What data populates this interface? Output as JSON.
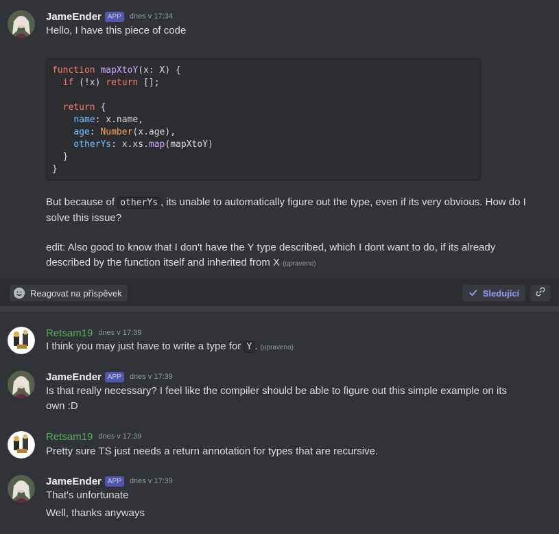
{
  "posts": {
    "first": {
      "author": "JameEnder",
      "badge": "APP",
      "time": "dnes v 17:34",
      "line1": "Hello, I have this piece of code",
      "code_lines": [
        "function mapXtoY(x: X) {",
        "  if (!x) return [];",
        "",
        "  return {",
        "    name: x.name,",
        "    age: Number(x.age),",
        "    otherYs: x.xs.map(mapXtoY)",
        "  }",
        "}"
      ],
      "para1_a": "But because of ",
      "para1_code": "otherYs",
      "para1_b": ", its unable to automatically figure out the type, even if its very obvious. How do I solve this issue?",
      "para2": "edit: Also good to know that I don't have the Y type described, which I dont want to do, if its already described by the function itself and inherited from X",
      "edited": "(upraveno)"
    }
  },
  "thread_bar": {
    "react_label": "Reagovat na příspěvek",
    "follow_label": "Sledující"
  },
  "replies": [
    {
      "author": "Retsam19",
      "time": "dnes v 17:39",
      "text_a": "I think you may just have to write a type for ",
      "code": "Y",
      "text_b": ".",
      "edited": "(upraveno)"
    },
    {
      "author": "JameEnder",
      "badge": "APP",
      "time": "dnes v 17:39",
      "text": "Is that really necessary? I feel like the compiler should be able to figure out this simple example on its own :D"
    },
    {
      "author": "Retsam19",
      "time": "dnes v 17:39",
      "text": "Pretty sure TS just needs a return annotation for types that are recursive."
    },
    {
      "author": "JameEnder",
      "badge": "APP",
      "time": "dnes v 17:39",
      "text": "That's unfortunate",
      "text2": "Well, thanks anyways"
    }
  ],
  "colors": {
    "background": "#313338",
    "accent": "#949cf7",
    "retsam_name": "#57ab5a"
  }
}
